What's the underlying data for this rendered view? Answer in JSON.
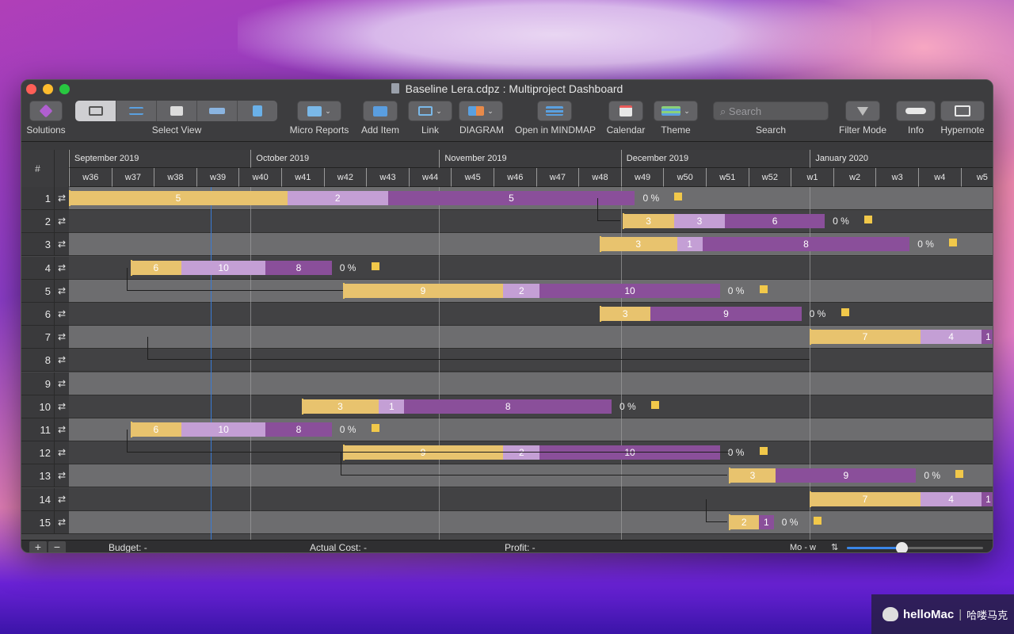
{
  "window": {
    "title": "Baseline  Lera.cdpz : Multiproject Dashboard"
  },
  "toolbar": {
    "solutions": "Solutions",
    "select_view": "Select View",
    "micro_reports": "Micro Reports",
    "add_item": "Add Item",
    "link": "Link",
    "diagram": "DIAGRAM",
    "open_mindmap": "Open in MINDMAP",
    "calendar": "Calendar",
    "theme": "Theme",
    "search_label": "Search",
    "search_placeholder": "Search",
    "filter_mode": "Filter Mode",
    "info": "Info",
    "hypernote": "Hypernote"
  },
  "gantt": {
    "hash": "#",
    "months": [
      "September 2019",
      "October 2019",
      "November 2019",
      "December 2019",
      "January 2020"
    ],
    "weeks": [
      "w36",
      "w37",
      "w38",
      "w39",
      "w40",
      "w41",
      "w42",
      "w43",
      "w44",
      "w45",
      "w46",
      "w47",
      "w48",
      "w49",
      "w50",
      "w51",
      "w52",
      "w1",
      "w2",
      "w3",
      "w4",
      "w5"
    ],
    "rows": [
      "1",
      "2",
      "3",
      "4",
      "5",
      "6",
      "7",
      "8",
      "9",
      "10",
      "11",
      "12",
      "13",
      "14",
      "15"
    ],
    "row_icon": "⇄",
    "segments": {
      "r1": [
        "5",
        "2",
        "5"
      ],
      "r2": [
        "3",
        "3",
        "6"
      ],
      "r3": [
        "3",
        "1",
        "8"
      ],
      "r4": [
        "6",
        "10",
        "8"
      ],
      "r5": [
        "9",
        "2",
        "10"
      ],
      "r6": [
        "3",
        "9"
      ],
      "r7": [
        "7",
        "4",
        "1"
      ],
      "r10": [
        "3",
        "1",
        "8"
      ],
      "r11": [
        "6",
        "10",
        "8"
      ],
      "r12": [
        "9",
        "2",
        "10"
      ],
      "r13": [
        "3",
        "9"
      ],
      "r14": [
        "7",
        "4",
        "1"
      ],
      "r15": [
        "2",
        "1"
      ]
    },
    "pct": "0 %"
  },
  "status": {
    "add": "+",
    "remove": "−",
    "budget": "Budget: -",
    "actual_cost": "Actual Cost: -",
    "profit": "Profit: -",
    "scale": "Mo - w",
    "zoom_level": 0.4
  },
  "watermark": {
    "brand": "helloMac",
    "cn": "哈喽马克"
  },
  "colors": {
    "planned": "#e8c36e",
    "progress": "#c49fd5",
    "remaining": "#8a4f9a",
    "milestone": "#f1c84a",
    "today_line": "#3a7bd5"
  }
}
